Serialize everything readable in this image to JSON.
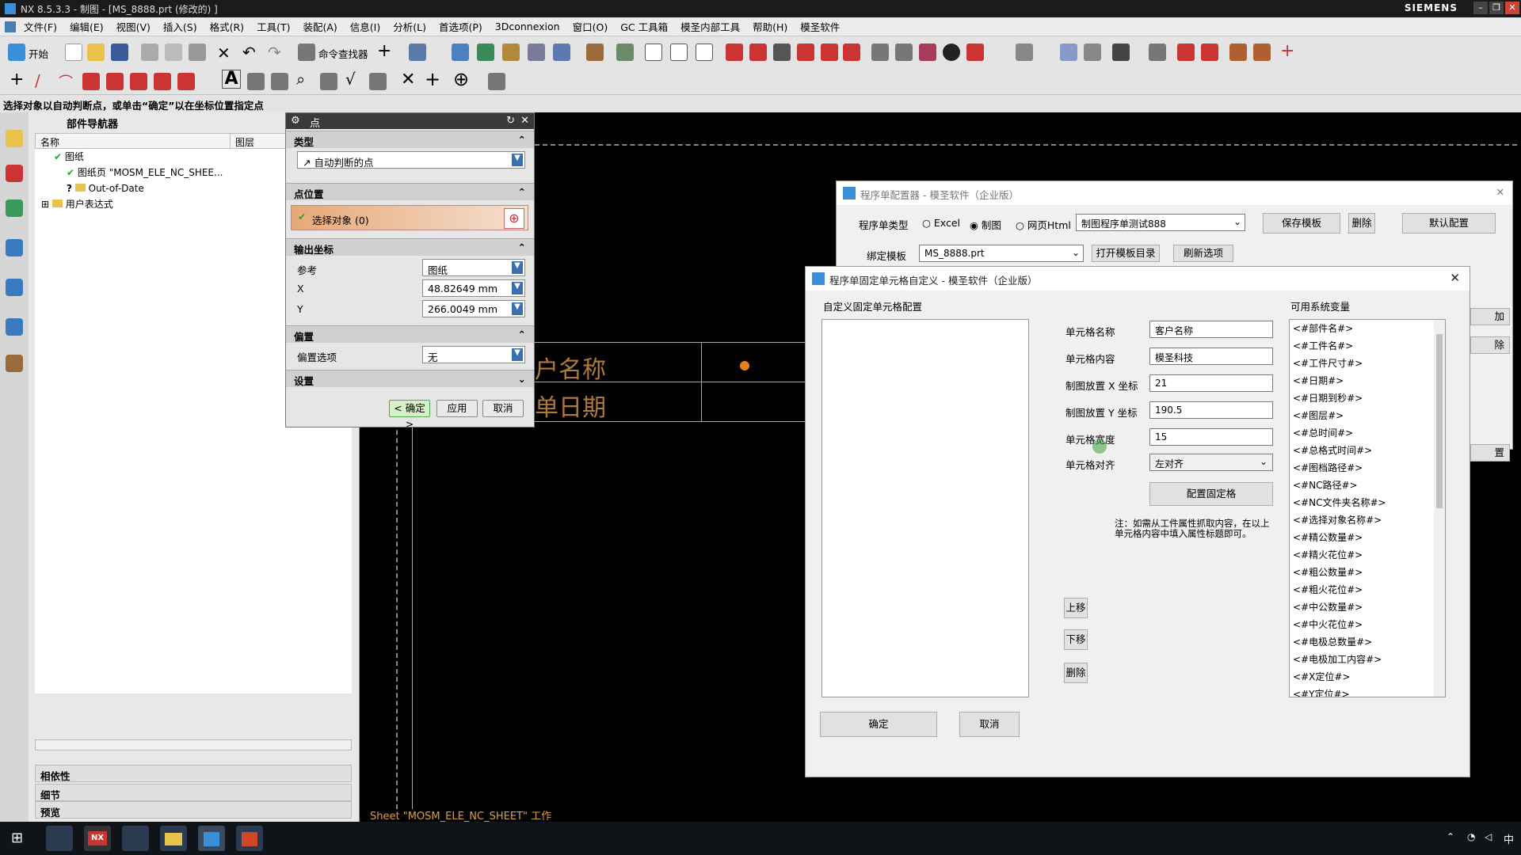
{
  "titlebar": {
    "title": "NX 8.5.3.3 - 制图 - [MS_8888.prt  (修改的)  ]",
    "brand": "SIEMENS"
  },
  "menu": [
    "文件(F)",
    "编辑(E)",
    "视图(V)",
    "插入(S)",
    "格式(R)",
    "工具(T)",
    "装配(A)",
    "信息(I)",
    "分析(L)",
    "首选项(P)",
    "3Dconnexion",
    "窗口(O)",
    "GC 工具箱",
    "模圣内部工具",
    "帮助(H)",
    "模圣软件"
  ],
  "toolbar": {
    "start_label": "开始",
    "command_finder_label": "命令查找器"
  },
  "status_prompt": "选择对象以自动判断点，或单击“确定”以在坐标位置指定点",
  "navigator": {
    "title": "部件导航器",
    "col_name": "名称",
    "col_layer": "图层",
    "tree": [
      "图纸",
      "图纸页 \"MOSM_ELE_NC_SHEE...",
      "Out-of-Date",
      "用户表达式"
    ],
    "panels": [
      "相依性",
      "细节",
      "预览"
    ]
  },
  "point_dialog": {
    "title": "点",
    "sec_type": "类型",
    "type_value": "自动判断的点",
    "sec_location": "点位置",
    "select_object": "选择对象 (0)",
    "sec_output": "输出坐标",
    "ref_label": "参考",
    "ref_value": "图纸",
    "x_label": "X",
    "x_value": "48.82649",
    "y_label": "Y",
    "y_value": "266.0049",
    "unit": "mm",
    "sec_offset": "偏置",
    "offset_label": "偏置选项",
    "offset_value": "无",
    "sec_settings": "设置",
    "ok": "< 确定 >",
    "apply": "应用",
    "cancel": "取消"
  },
  "canvas": {
    "cell1": "户名称",
    "cell2": "单日期",
    "sheet_status": "Sheet \"MOSM_ELE_NC_SHEET\" 工作"
  },
  "configurator": {
    "title": "程序单配置器 - 模圣软件（企业版）",
    "type_label": "程序单类型",
    "radio_excel": "Excel",
    "radio_drawing": "制图",
    "radio_html": "网页Html",
    "template_name": "制图程序单测试888",
    "save_template": "保存模板",
    "delete": "删除",
    "default_config": "默认配置",
    "bind_label": "绑定模板",
    "bind_value": "MS_8888.prt",
    "open_dir": "打开模板目录",
    "refresh": "刷新选项",
    "right_btn1": "加",
    "right_btn2": "除",
    "right_btn3": "置"
  },
  "cell_dialog": {
    "title": "程序单固定单元格自定义 - 模圣软件（企业版）",
    "config_label": "自定义固定单元格配置",
    "name_label": "单元格名称",
    "name_value": "客户名称",
    "content_label": "单元格内容",
    "content_value": "模圣科技",
    "x_label": "制图放置 X 坐标",
    "x_value": "21",
    "y_label": "制图放置 Y 坐标",
    "y_value": "190.5",
    "width_label": "单元格宽度",
    "width_value": "15",
    "align_label": "单元格对齐",
    "align_value": "左对齐",
    "config_btn": "配置固定格",
    "note": "注：如需从工件属性抓取内容，在以上单元格内容中填入属性标题即可。",
    "up": "上移",
    "down": "下移",
    "del": "删除",
    "ok": "确定",
    "cancel": "取消",
    "vars_label": "可用系统变量",
    "vars": [
      "<#部件名#>",
      "<#工件名#>",
      "<#工件尺寸#>",
      "<#日期#>",
      "<#日期到秒#>",
      "<#图层#>",
      "<#总时间#>",
      "<#总格式时间#>",
      "<#图档路径#>",
      "<#NC路径#>",
      "<#NC文件夹名称#>",
      "<#选择对象名称#>",
      "<#精公数量#>",
      "<#精火花位#>",
      "<#粗公数量#>",
      "<#粗火花位#>",
      "<#中公数量#>",
      "<#中火花位#>",
      "<#电极总数量#>",
      "<#电极加工内容#>",
      "<#X定位#>",
      "<#Y定位#>"
    ]
  },
  "taskbar": {
    "ime": "中"
  }
}
